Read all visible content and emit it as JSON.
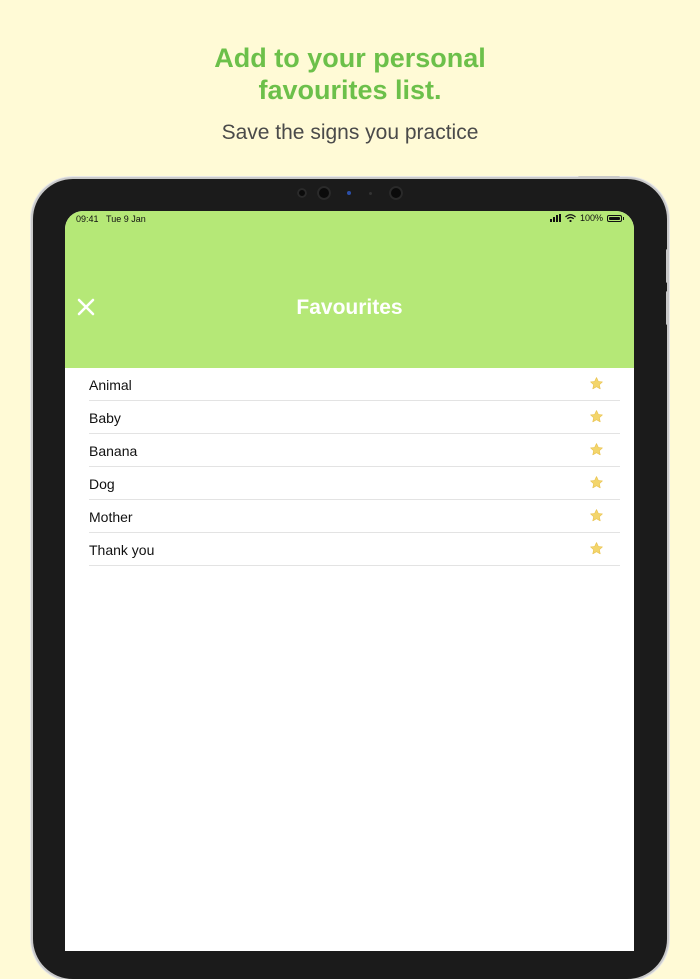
{
  "promo": {
    "headline_line1": "Add to your personal",
    "headline_line2": "favourites list.",
    "subline": "Save the signs you practice"
  },
  "status_bar": {
    "time": "09:41",
    "date": "Tue 9 Jan",
    "battery": "100%"
  },
  "nav": {
    "title": "Favourites",
    "close_icon": "close-icon"
  },
  "favourites": [
    {
      "label": "Animal"
    },
    {
      "label": "Baby"
    },
    {
      "label": "Banana"
    },
    {
      "label": "Dog"
    },
    {
      "label": "Mother"
    },
    {
      "label": "Thank you"
    }
  ],
  "colors": {
    "background": "#fffad6",
    "headline": "#6cc04a",
    "nav_bar": "#b5e877",
    "star": "#f3d56b"
  }
}
